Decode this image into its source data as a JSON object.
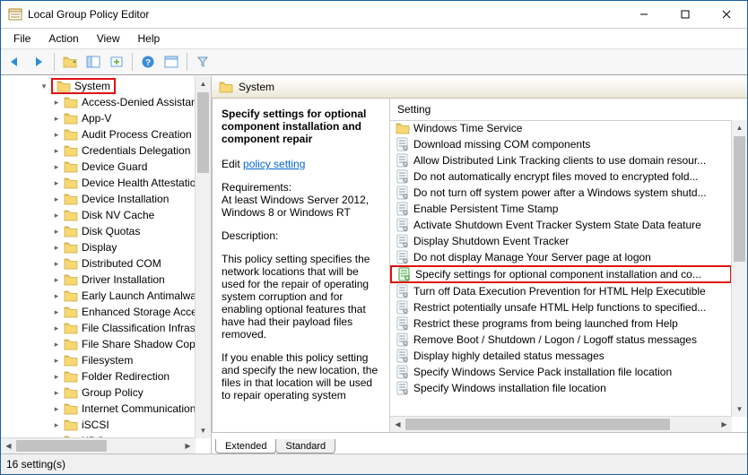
{
  "window": {
    "title": "Local Group Policy Editor"
  },
  "menu": {
    "file": "File",
    "action": "Action",
    "view": "View",
    "help": "Help"
  },
  "tree": {
    "root": "System",
    "items": [
      "Access-Denied Assistan",
      "App-V",
      "Audit Process Creation",
      "Credentials Delegation",
      "Device Guard",
      "Device Health Attestatio",
      "Device Installation",
      "Disk NV Cache",
      "Disk Quotas",
      "Display",
      "Distributed COM",
      "Driver Installation",
      "Early Launch Antimalwa",
      "Enhanced Storage Acce",
      "File Classification Infras",
      "File Share Shadow Copy",
      "Filesystem",
      "Folder Redirection",
      "Group Policy",
      "Internet Communication",
      "iSCSI",
      "KDC"
    ]
  },
  "header": {
    "title": "System"
  },
  "desc": {
    "title": "Specify settings for optional component installation and component repair",
    "edit_prefix": "Edit",
    "edit_link": "policy setting",
    "req_label": "Requirements:",
    "req_text": "At least Windows Server 2012, Windows 8 or Windows RT",
    "desc_label": "Description:",
    "p1": "This policy setting specifies the network locations that will be used for the repair of operating system corruption and for enabling optional features that have had their payload files removed.",
    "p2": "If you enable this policy setting and specify the new location, the files in that location will be used to repair operating system"
  },
  "list": {
    "header": "Setting",
    "items": [
      {
        "type": "folder",
        "text": "Windows Time Service"
      },
      {
        "type": "policy",
        "text": "Download missing COM components"
      },
      {
        "type": "policy",
        "text": "Allow Distributed Link Tracking clients to use domain resour..."
      },
      {
        "type": "policy",
        "text": "Do not automatically encrypt files moved to encrypted fold..."
      },
      {
        "type": "policy",
        "text": "Do not turn off system power after a Windows system shutd..."
      },
      {
        "type": "policy",
        "text": "Enable Persistent Time Stamp"
      },
      {
        "type": "policy",
        "text": "Activate Shutdown Event Tracker System State Data feature"
      },
      {
        "type": "policy",
        "text": "Display Shutdown Event Tracker"
      },
      {
        "type": "policy",
        "text": "Do not display Manage Your Server page at logon"
      },
      {
        "type": "policy",
        "text": "Specify settings for optional component installation and co...",
        "highlight": true
      },
      {
        "type": "policy",
        "text": "Turn off Data Execution Prevention for HTML Help Executible"
      },
      {
        "type": "policy",
        "text": "Restrict potentially unsafe HTML Help functions to specified..."
      },
      {
        "type": "policy",
        "text": "Restrict these programs from being launched from Help"
      },
      {
        "type": "policy",
        "text": "Remove Boot / Shutdown / Logon / Logoff status messages"
      },
      {
        "type": "policy",
        "text": "Display highly detailed status messages"
      },
      {
        "type": "policy",
        "text": "Specify Windows Service Pack installation file location"
      },
      {
        "type": "policy",
        "text": "Specify Windows installation file location"
      }
    ]
  },
  "tabs": {
    "extended": "Extended",
    "standard": "Standard"
  },
  "status": {
    "text": "16 setting(s)"
  }
}
